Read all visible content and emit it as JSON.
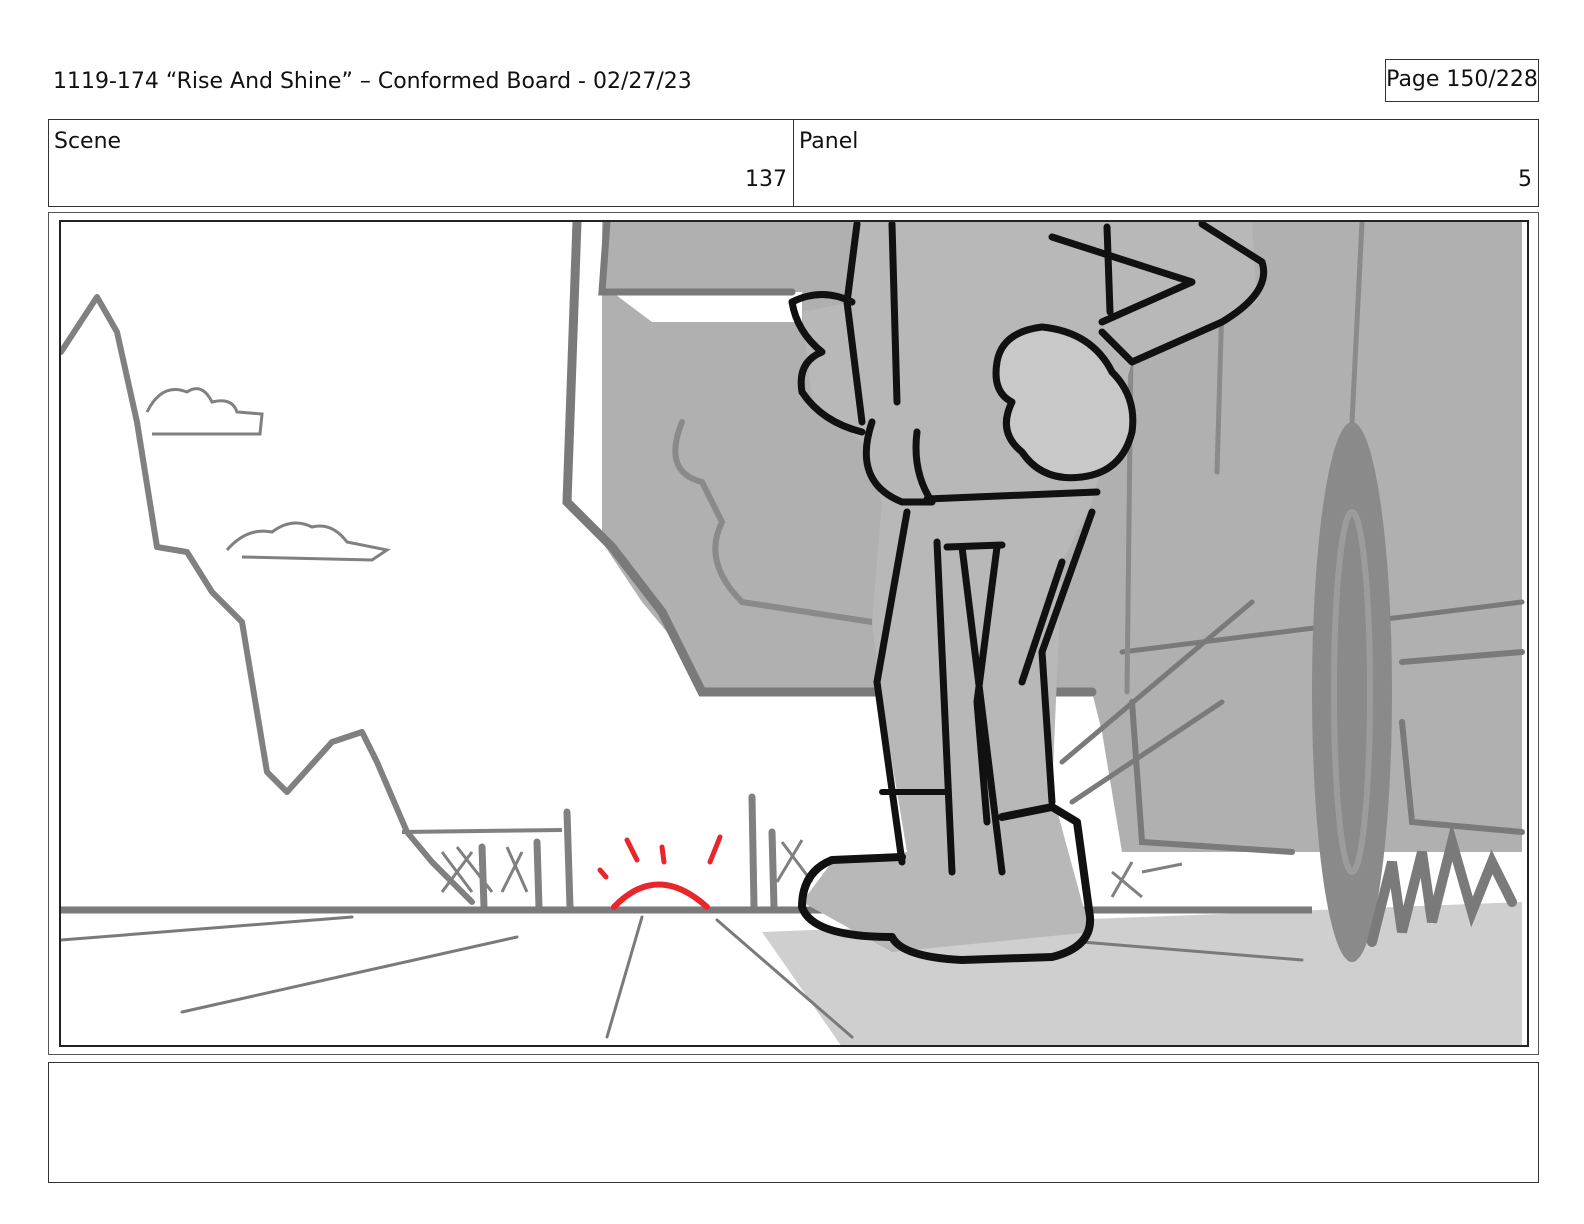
{
  "header": {
    "title": "1119-174 “Rise And Shine” – Conformed Board - 02/27/23",
    "page_label": "Page 150/228"
  },
  "info": {
    "scene_label": "Scene",
    "scene_value": "137",
    "panel_label": "Panel",
    "panel_value": "5"
  },
  "board": {
    "drawing": "storyboard-sketch",
    "accent_color": "#e8262b",
    "ink_color": "#111111",
    "tone_color": "#b0b0b0",
    "line_color": "#7a7a7a"
  },
  "notes": {
    "text": ""
  }
}
